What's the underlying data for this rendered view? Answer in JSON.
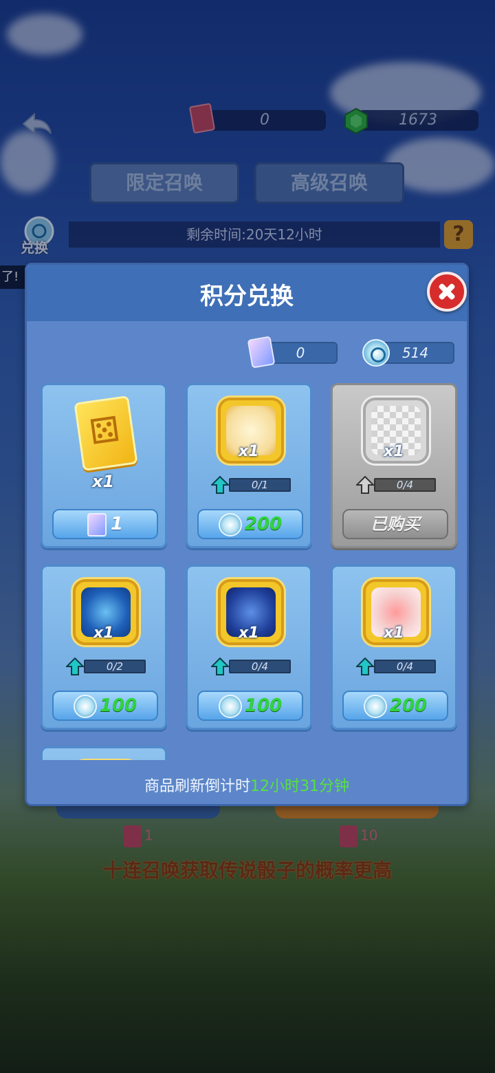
{
  "header": {
    "dice_count": "0",
    "gem_count": "1673",
    "tabs": [
      "限定召唤",
      "高级召唤"
    ],
    "remaining_time": "剩余时间:20天12小时",
    "help_symbol": "?",
    "exchange_label": "兑换",
    "ticker_text": "了!"
  },
  "background": {
    "single_cost": "1",
    "ten_cost": "10",
    "tip": "十连召唤获取传说骰子的概率更高"
  },
  "modal": {
    "title": "积分兑换",
    "wallet_dice": "0",
    "wallet_points": "514",
    "items": [
      {
        "qty": "x1",
        "price": "1",
        "type": "dice-card"
      },
      {
        "qty": "x1",
        "progress": "0/1",
        "price": "200"
      },
      {
        "qty": "x1",
        "progress": "0/4",
        "price": "已购买",
        "bought": true
      },
      {
        "qty": "x1",
        "progress": "0/2",
        "price": "100"
      },
      {
        "qty": "x1",
        "progress": "0/4",
        "price": "100"
      },
      {
        "qty": "x1",
        "progress": "0/4",
        "price": "200"
      }
    ],
    "refresh_prefix": "商品刷新倒计时",
    "refresh_time": "12小时31分钟"
  },
  "colors": {
    "accent_green": "#57e23f",
    "close_red": "#d62c2c",
    "modal_blue": "#5c86c9"
  }
}
